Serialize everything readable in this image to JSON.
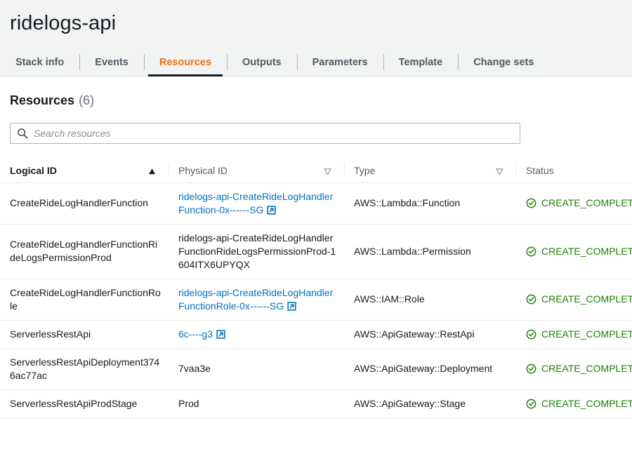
{
  "header": {
    "stack_title": "ridelogs-api",
    "tabs": [
      {
        "label": "Stack info",
        "active": false
      },
      {
        "label": "Events",
        "active": false
      },
      {
        "label": "Resources",
        "active": true
      },
      {
        "label": "Outputs",
        "active": false
      },
      {
        "label": "Parameters",
        "active": false
      },
      {
        "label": "Template",
        "active": false
      },
      {
        "label": "Change sets",
        "active": false
      }
    ],
    "active_tab_color": "#ec7211"
  },
  "section": {
    "title": "Resources",
    "count": "(6)"
  },
  "search": {
    "placeholder": "Search resources",
    "value": "",
    "icon": "search-icon"
  },
  "table": {
    "columns": [
      {
        "label": "Logical ID",
        "sort": "ascending",
        "sort_icon": "sort-ascending-icon"
      },
      {
        "label": "Physical ID",
        "sort": "sortable",
        "sort_icon": "sort-descending-icon"
      },
      {
        "label": "Type",
        "sort": "sortable",
        "sort_icon": "sort-descending-icon"
      },
      {
        "label": "Status",
        "sort": "none",
        "sort_icon": ""
      }
    ],
    "rows": [
      {
        "logical_id": "CreateRideLogHandlerFunction",
        "physical_id": "ridelogs-api-CreateRideLogHandlerFunction-0x------SG",
        "physical_is_link": true,
        "type": "AWS::Lambda::Function",
        "status": "CREATE_COMPLETE",
        "status_icon": "status-success-icon"
      },
      {
        "logical_id": "CreateRideLogHandlerFunctionRideLogsPermissionProd",
        "physical_id": "ridelogs-api-CreateRideLogHandlerFunctionRideLogsPermissionProd-1604ITX6UPYQX",
        "physical_is_link": false,
        "type": "AWS::Lambda::Permission",
        "status": "CREATE_COMPLETE",
        "status_icon": "status-success-icon"
      },
      {
        "logical_id": "CreateRideLogHandlerFunctionRole",
        "physical_id": "ridelogs-api-CreateRideLogHandlerFunctionRole-0x------SG",
        "physical_is_link": true,
        "type": "AWS::IAM::Role",
        "status": "CREATE_COMPLETE",
        "status_icon": "status-success-icon"
      },
      {
        "logical_id": "ServerlessRestApi",
        "physical_id": "6c----g3",
        "physical_is_link": true,
        "type": "AWS::ApiGateway::RestApi",
        "status": "CREATE_COMPLETE",
        "status_icon": "status-success-icon"
      },
      {
        "logical_id": "ServerlessRestApiDeployment3746ac77ac",
        "physical_id": "7vaa3e",
        "physical_is_link": false,
        "type": "AWS::ApiGateway::Deployment",
        "status": "CREATE_COMPLETE",
        "status_icon": "status-success-icon"
      },
      {
        "logical_id": "ServerlessRestApiProdStage",
        "physical_id": "Prod",
        "physical_is_link": false,
        "type": "AWS::ApiGateway::Stage",
        "status": "CREATE_COMPLETE",
        "status_icon": "status-success-icon"
      }
    ]
  },
  "colors": {
    "accent_orange": "#ec7211",
    "link_blue": "#0073bb",
    "status_green": "#1d8102",
    "header_bg": "#f2f3f3",
    "border": "#eaeded"
  }
}
